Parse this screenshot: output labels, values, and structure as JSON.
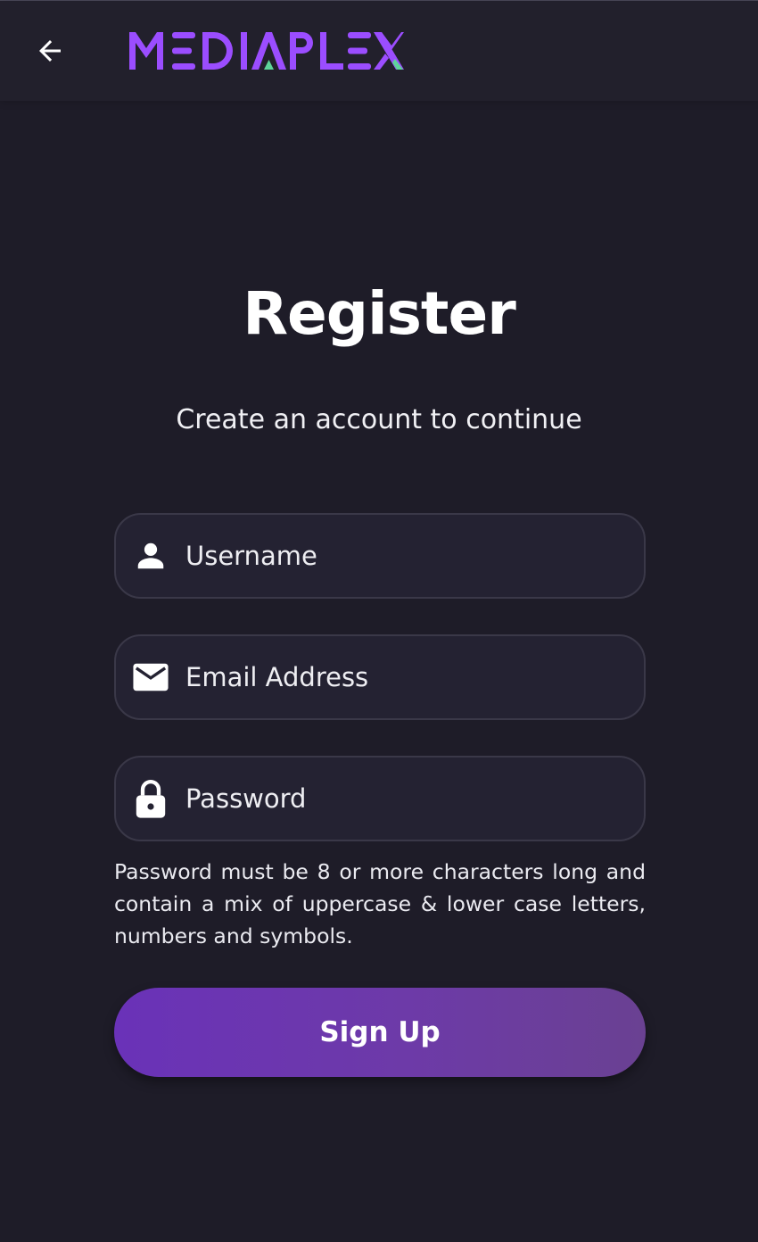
{
  "header": {
    "back_icon": "arrow-left-icon",
    "logo_text": "MEDIAPLEX",
    "logo_color": "#9b4dff",
    "logo_accent_color": "#5ed49a"
  },
  "page": {
    "title": "Register",
    "subtitle": "Create an account to continue"
  },
  "form": {
    "username": {
      "placeholder": "Username",
      "value": "",
      "icon": "person-icon"
    },
    "email": {
      "placeholder": "Email Address",
      "value": "",
      "icon": "envelope-icon"
    },
    "password": {
      "placeholder": "Password",
      "value": "",
      "icon": "lock-icon"
    },
    "password_hint": "Password must be 8 or more characters long and contain a mix of uppercase & lower case letters, numbers and symbols.",
    "submit_label": "Sign Up"
  },
  "colors": {
    "background": "#1e1c28",
    "button_gradient_start": "#6a32b8",
    "button_gradient_end": "#6a4192"
  }
}
